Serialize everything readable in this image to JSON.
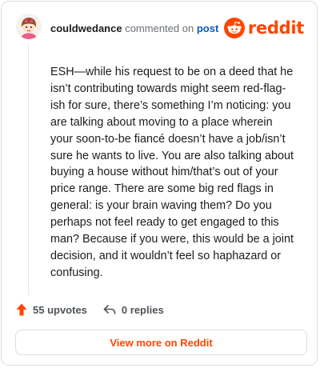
{
  "header": {
    "username": "couldwedance",
    "commented_text": "commented on",
    "post_link": "post",
    "brand_name": "reddit",
    "brand_color": "#ff4500"
  },
  "comment": {
    "text": "ESH—while his request to be on a deed that he isn’t contributing towards might seem red-flag-ish for sure, there’s something I’m noticing: you are talking about moving to a place wherein your soon-to-be fiancé doesn’t have a job/isn’t sure he wants to live. You are also talking about buying a house without him/that’s out of your price range. There are some big red flags in general: is your brain waving them? Do you perhaps not feel ready to get engaged to this man? Because if you were, this would be a joint decision, and it wouldn’t feel so haphazard or confusing."
  },
  "actions": {
    "upvotes": "55 upvotes",
    "replies": "0 replies",
    "upvote_icon": "upvote-arrow-icon",
    "reply_icon": "reply-arrow-icon"
  },
  "footer": {
    "view_more": "View more on Reddit"
  }
}
